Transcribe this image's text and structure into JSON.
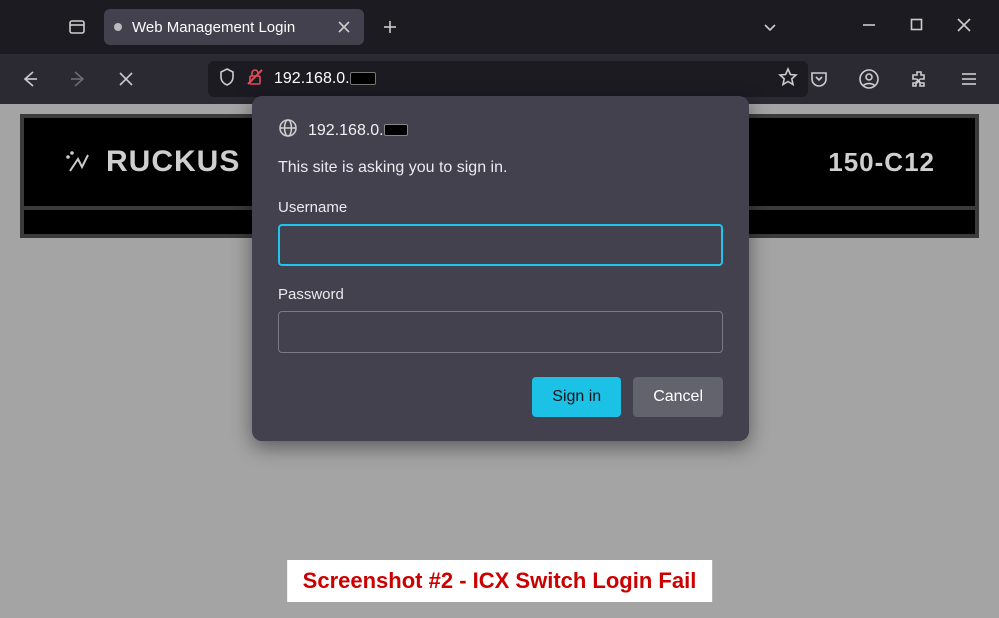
{
  "browser": {
    "tab_title": "Web Management Login",
    "address_prefix": "192.168.0."
  },
  "dialog": {
    "host_prefix": "192.168.0.",
    "message": "This site is asking you to sign in.",
    "username_label": "Username",
    "password_label": "Password",
    "username_value": "",
    "password_value": "",
    "signin_label": "Sign in",
    "cancel_label": "Cancel"
  },
  "page": {
    "brand": "RUCKUS",
    "model_suffix": "150-C12"
  },
  "caption": "Screenshot #2  -  ICX Switch Login Fail"
}
